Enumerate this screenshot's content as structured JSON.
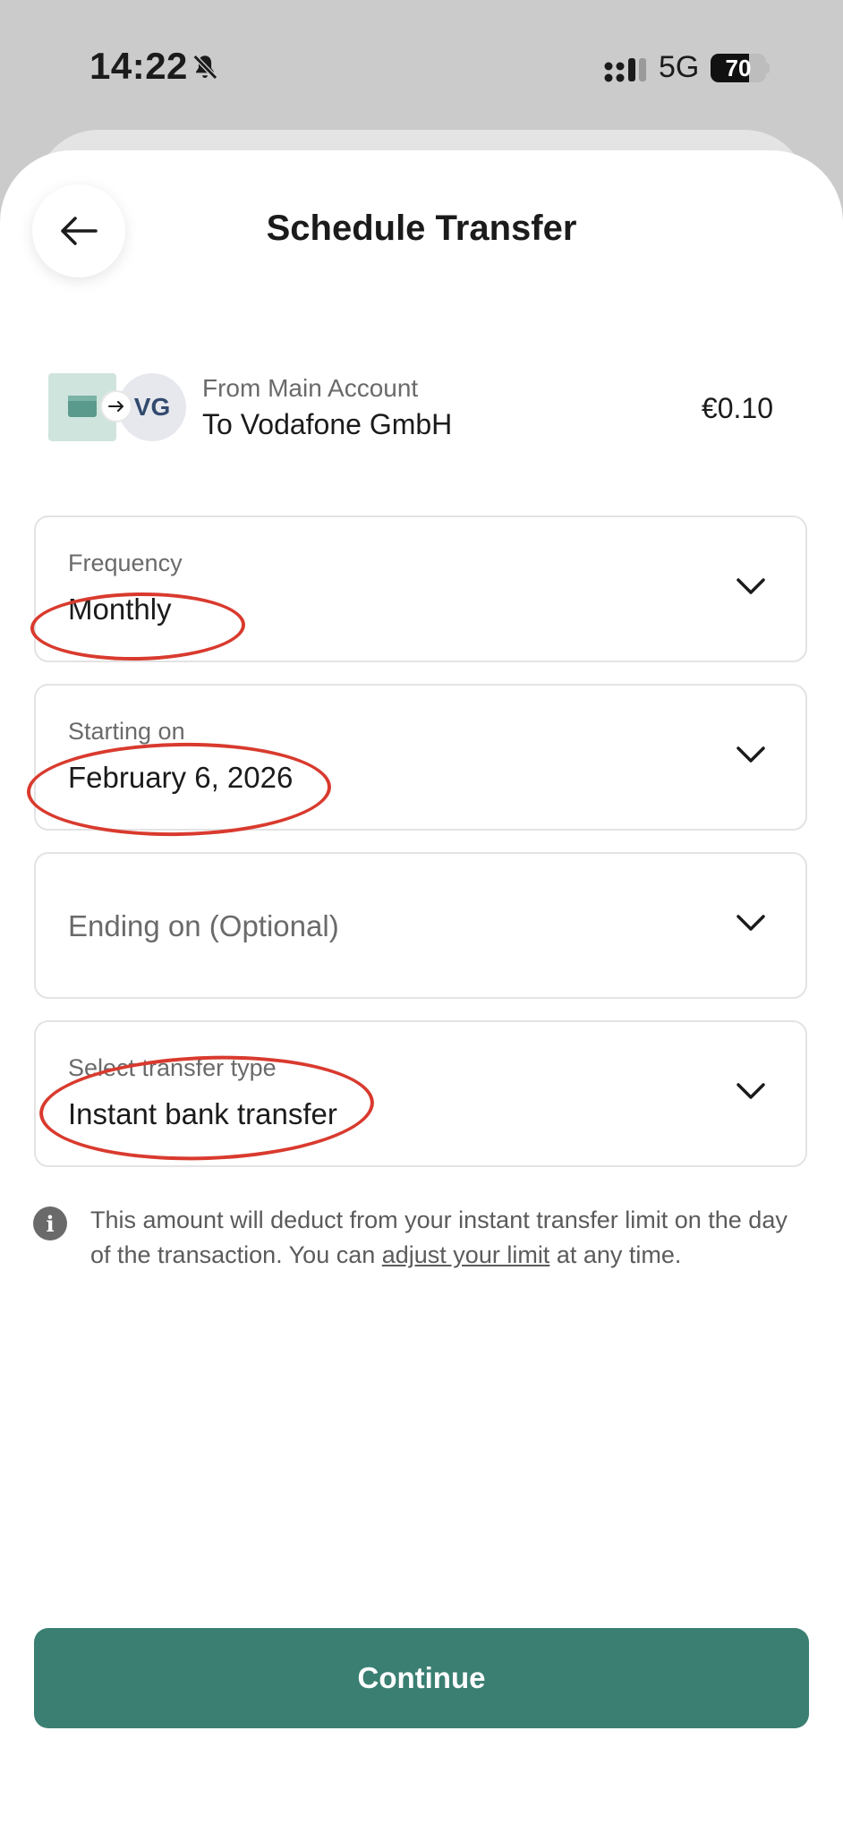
{
  "status_bar": {
    "time": "14:22",
    "network": "5G",
    "battery": "70",
    "battery_level": 0.7
  },
  "header": {
    "title": "Schedule Transfer"
  },
  "summary": {
    "from_label": "From Main Account",
    "to_label": "To Vodafone GmbH",
    "recipient_initials": "VG",
    "amount": "€0.10"
  },
  "fields": {
    "frequency": {
      "label": "Frequency",
      "value": "Monthly"
    },
    "starting_on": {
      "label": "Starting on",
      "value": "February 6, 2026"
    },
    "ending_on": {
      "placeholder": "Ending on (Optional)"
    },
    "transfer_type": {
      "label": "Select transfer type",
      "value": "Instant bank transfer"
    }
  },
  "info": {
    "text_before": "This amount will deduct from your instant transfer limit on the day of the transaction. You can ",
    "link": "adjust your limit",
    "text_after": " at any time."
  },
  "buttons": {
    "continue": "Continue"
  },
  "colors": {
    "primary": "#3a7f72",
    "annotation": "#d93a2e",
    "account_icon": "#cfe4dc"
  }
}
